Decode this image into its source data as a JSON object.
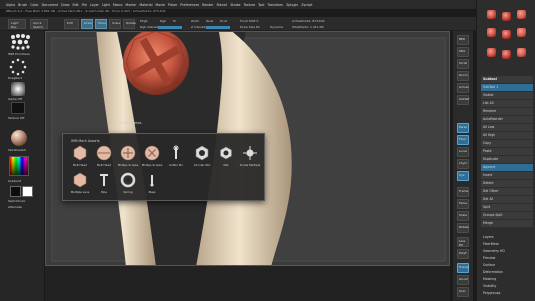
{
  "menubar": {
    "items": [
      "Alpha",
      "Brush",
      "Color",
      "Document",
      "Draw",
      "Edit",
      "File",
      "Layer",
      "Light",
      "Macro",
      "Marker",
      "Material",
      "Movie",
      "Picker",
      "Preferences",
      "Render",
      "Stencil",
      "Stroke",
      "Texture",
      "Tool",
      "Transform",
      "Zplugin",
      "Zscript"
    ]
  },
  "status": {
    "text": "ZBrush 4.0 - Free Mem 3.891 GB - Active Mem 861 - Scratch Disk 48 - Timer 0.003 - ActivePoints: 873,632"
  },
  "top_shelf": {
    "buttons": [
      "Light Box",
      "Quick Sketch",
      "Edit",
      "Draw",
      "Move",
      "Scale",
      "Rotate"
    ],
    "mrgb": "Mrgb",
    "rgb": "Rgb",
    "m": "M",
    "zadd": "Zadd",
    "zsub": "Zsub",
    "zcut": "Zcut",
    "rgb_intensity": "Rgb Intensity 100",
    "z_intensity": "Z Intensity 100",
    "focal_shift": "Focal Shift 0",
    "draw_size": "Draw Size 64",
    "dynamic": "Dynamic",
    "active_points": "ActivePoints: 873,632",
    "total_points": "TotalPoints: 1.411 Mil"
  },
  "left_shelf": {
    "brush_label": "IMM Primitives",
    "stroke_label": "DragRect",
    "alpha_label": "Alpha Off",
    "texture_label": "Texture Off",
    "material_label": "SkinShade4",
    "gradient_label": "Gradient",
    "switch_label": "SwitchColor",
    "alternate_label": "Alternate"
  },
  "popup": {
    "title": "IMM Mech Assorts",
    "tooltip": "Philips Screws",
    "items": [
      {
        "label": "Bolt Head"
      },
      {
        "label": "Bolt Head"
      },
      {
        "label": "Phillips Screws"
      },
      {
        "label": "Phillips Screws"
      },
      {
        "label": "Cutter Pin"
      },
      {
        "label": "Circular Nut"
      },
      {
        "label": "Nut"
      },
      {
        "label": "Screw Multiple"
      },
      {
        "label": "Multiple Lens"
      },
      {
        "label": "Pipe"
      },
      {
        "label": "Spring"
      },
      {
        "label": "Peep"
      }
    ]
  },
  "right_toolbar": {
    "buttons": [
      "BPR",
      "SPix",
      "Scroll",
      "Zoom",
      "Actual",
      "AAHalf",
      "Persp",
      "Floor",
      "Local",
      "LSym",
      "Xyz",
      "Frame",
      "Move",
      "Scale",
      "Rotate",
      "Line Fill",
      "PolyF",
      "Transp",
      "Ghost",
      "Solo",
      "Xpose"
    ]
  },
  "right_palette": {
    "items": [
      "Subtool",
      "SubTool 1",
      "Visible",
      "List All",
      "Rename",
      "AutoReorder",
      "All Low",
      "All High",
      "Copy",
      "Paste",
      "Duplicate",
      "Append",
      "Insert",
      "Delete",
      "Del Other",
      "Del All",
      "Split",
      "Groups Split",
      "Merge",
      "MergeDown",
      "MergeSimilar",
      "MergeVisible",
      "Weld",
      "Uv",
      "Remesh",
      "Project",
      "Extract",
      "Layers",
      "FiberMesh",
      "Geometry HD",
      "Preview",
      "Surface",
      "Deformation",
      "Masking",
      "Visibility",
      "Polygroups"
    ],
    "subtool_colors": [
      "#c9473c",
      "#b63a33",
      "#d0584a"
    ]
  }
}
